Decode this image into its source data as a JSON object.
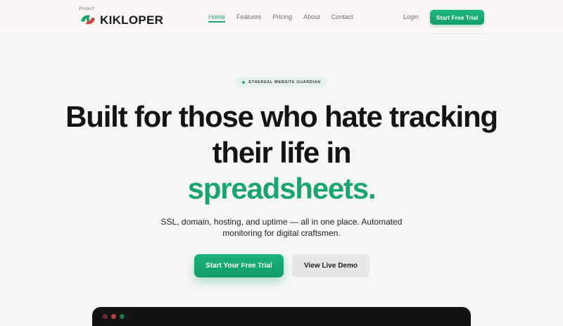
{
  "nav": {
    "logo_prefix": "Project",
    "logo_text": "KIKLOPER",
    "items": [
      {
        "label": "Home",
        "active": true
      },
      {
        "label": "Features",
        "active": false
      },
      {
        "label": "Pricing",
        "active": false
      },
      {
        "label": "About",
        "active": false
      },
      {
        "label": "Contact",
        "active": false
      }
    ],
    "login_label": "Login",
    "cta_label": "Start Free Trial"
  },
  "hero": {
    "badge": "ETHEREAL WEBSITE GUARDIAN",
    "headline_line1": "Built for those who hate tracking",
    "headline_line2": "their life in",
    "headline_highlight": "spreadsheets.",
    "subheading": "SSL, domain, hosting, and uptime — all in one place. Automated monitoring for digital craftsmen.",
    "primary_cta": "Start Your Free Trial",
    "secondary_cta": "View Live Demo"
  },
  "colors": {
    "accent": "#1aa46f",
    "logo_green": "#17a06a",
    "logo_red": "#d63a3a",
    "window_bg": "#141414"
  },
  "icons": {
    "logo": "kikloper-logo-icon",
    "badge_dot": "status-dot-icon"
  }
}
